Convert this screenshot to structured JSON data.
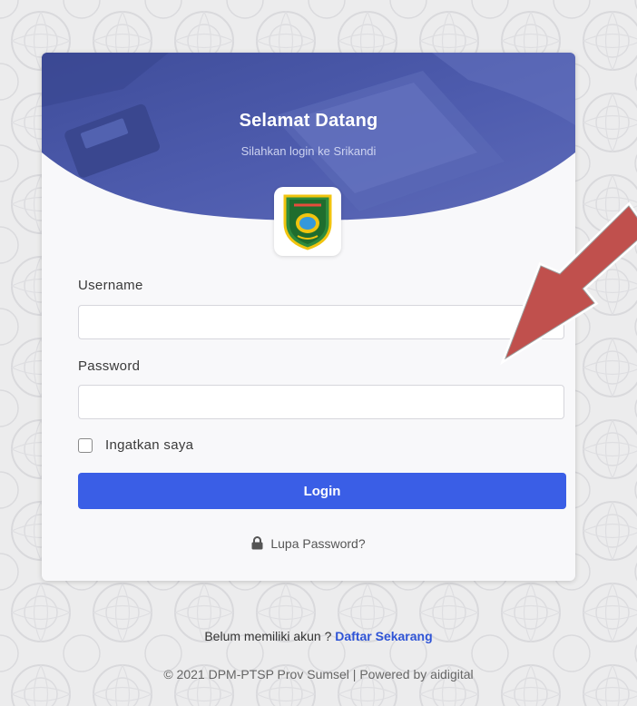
{
  "header": {
    "title": "Selamat Datang",
    "subtitle": "Silahkan login ke Srikandi"
  },
  "logo": {
    "icon": "provincial-emblem-icon"
  },
  "form": {
    "username_label": "Username",
    "username_value": "",
    "password_label": "Password",
    "password_value": "",
    "remember_label": "Ingatkan saya",
    "remember_checked": false,
    "login_label": "Login",
    "forgot_label": "Lupa Password?"
  },
  "footer": {
    "register_prompt": "Belum memiliki akun ? ",
    "register_link": "Daftar Sekarang",
    "copyright": "© 2021 DPM-PTSP Prov Sumsel | Powered by aidigital"
  },
  "colors": {
    "primary": "#3a5ee6",
    "header": "#4a58a8",
    "arrow": "#c0504d"
  }
}
